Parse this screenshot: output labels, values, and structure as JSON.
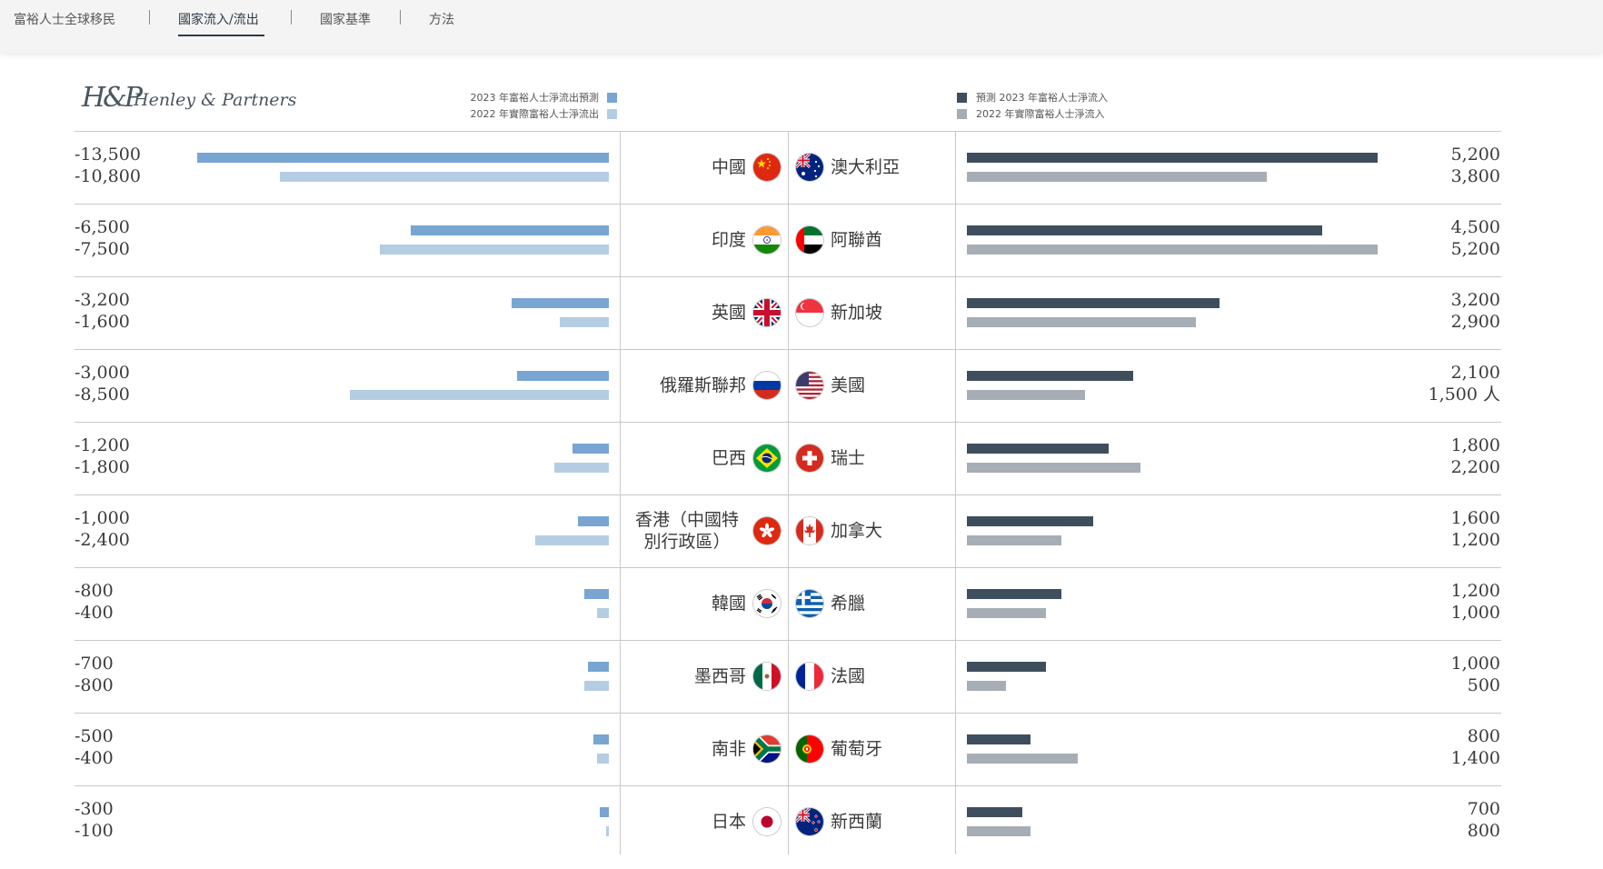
{
  "nav": {
    "tabs": [
      {
        "label": "富裕人士全球移民"
      },
      {
        "label": "國家流入/流出"
      },
      {
        "label": "國家基準"
      },
      {
        "label": "方法"
      }
    ],
    "active_tab": 1
  },
  "brand": {
    "mark": "H&P",
    "name": "Henley & Partners"
  },
  "colors": {
    "outflow_2023": "#78a5d2",
    "outflow_2022": "#b5cde3",
    "inflow_2023": "#3f4e5d",
    "inflow_2022": "#a6adb4"
  },
  "chart_data": {
    "type": "bar",
    "orientation": "horizontal",
    "legend": {
      "outflow_2023": "2023 年富裕人士淨流出預測",
      "outflow_2022": "2022 年實際富裕人士淨流出",
      "inflow_2023": "預測 2023 年富裕人士淨流入",
      "inflow_2022": "2022 年實際富裕人士淨流入"
    },
    "outflow_countries": [
      "中國",
      "印度",
      "英國",
      "俄羅斯聯邦",
      "巴西",
      "香港（中國特別行政區）",
      "韓國",
      "墨西哥",
      "南非",
      "日本"
    ],
    "inflow_countries": [
      "澳大利亞",
      "阿聯酋",
      "新加坡",
      "美國",
      "瑞士",
      "加拿大",
      "希臘",
      "法國",
      "葡萄牙",
      "新西蘭"
    ],
    "series": [
      {
        "name": "2023 年富裕人士淨流出預測",
        "values": [
          -13500,
          -6500,
          -3200,
          -3000,
          -1200,
          -1000,
          -800,
          -700,
          -500,
          -300
        ]
      },
      {
        "name": "2022 年實際富裕人士淨流出",
        "values": [
          -10800,
          -7500,
          -1600,
          -8500,
          -1800,
          -2400,
          -400,
          -800,
          -400,
          -100
        ]
      },
      {
        "name": "預測 2023 年富裕人士淨流入",
        "values": [
          5200,
          4500,
          3200,
          2100,
          1800,
          1600,
          1200,
          1000,
          800,
          700
        ]
      },
      {
        "name": "2022 年實際富裕人士淨流入",
        "values": [
          3800,
          5200,
          2900,
          1500,
          2200,
          1200,
          1000,
          500,
          1400,
          800
        ]
      }
    ],
    "labels": {
      "outflow_2023": [
        "-13,500",
        "-6,500",
        "-3,200",
        "-3,000",
        "-1,200",
        "-1,000",
        "-800",
        "-700",
        "-500",
        "-300"
      ],
      "outflow_2022": [
        "-10,800",
        "-7,500",
        "-1,600",
        "-8,500",
        "-1,800",
        "-2,400",
        "-400",
        "-800",
        "-400",
        "-100"
      ],
      "inflow_2023": [
        "5,200",
        "4,500",
        "3,200",
        "2,100",
        "1,800",
        "1,600",
        "1,200",
        "1,000",
        "800",
        "700"
      ],
      "inflow_2022": [
        "3,800",
        "5,200",
        "2,900",
        "1,500 人",
        "2,200",
        "1,200",
        "1,000",
        "500",
        "1,400",
        "800"
      ]
    },
    "flags": {
      "outflow": [
        "flag-china",
        "flag-india",
        "flag-uk",
        "flag-russia",
        "flag-brazil",
        "flag-hong-kong",
        "flag-south-korea",
        "flag-mexico",
        "flag-south-africa",
        "flag-japan"
      ],
      "inflow": [
        "flag-australia",
        "flag-uae",
        "flag-singapore",
        "flag-usa",
        "flag-switzerland",
        "flag-canada",
        "flag-greece",
        "flag-france",
        "flag-portugal",
        "flag-new-zealand"
      ]
    },
    "outflow_xlim": [
      -13500,
      0
    ],
    "inflow_xlim": [
      0,
      5200
    ],
    "grid": false
  }
}
